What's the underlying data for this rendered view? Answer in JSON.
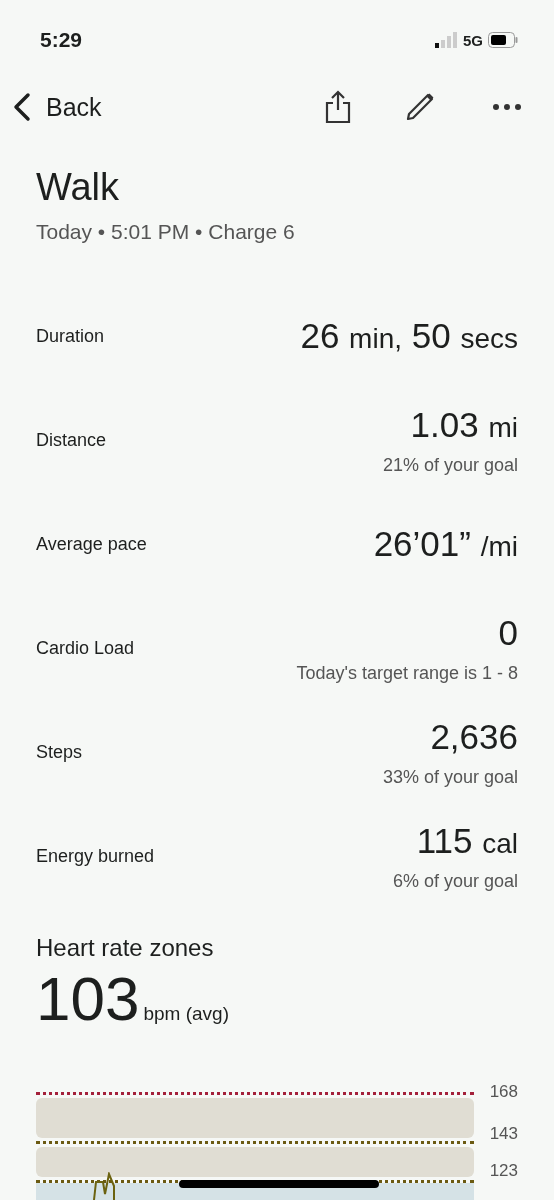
{
  "status_bar": {
    "time": "5:29",
    "network": "5G"
  },
  "nav": {
    "back_label": "Back"
  },
  "title": "Walk",
  "subtitle": "Today • 5:01 PM • Charge 6",
  "metrics": [
    {
      "label": "Duration",
      "value": [
        {
          "kind": "number",
          "text": "26"
        },
        {
          "kind": "unit",
          "text": "min,"
        },
        {
          "kind": "number",
          "text": "50"
        },
        {
          "kind": "unit",
          "text": "secs"
        }
      ]
    },
    {
      "label": "Distance",
      "value": [
        {
          "kind": "number",
          "text": "1.03"
        },
        {
          "kind": "unit",
          "text": "mi"
        }
      ],
      "note": "21% of your goal"
    },
    {
      "label": "Average pace",
      "value": [
        {
          "kind": "number",
          "text": "26’01”"
        },
        {
          "kind": "unit",
          "text": "/mi"
        }
      ]
    },
    {
      "label": "Cardio Load",
      "value": [
        {
          "kind": "number",
          "text": "0"
        }
      ],
      "note": "Today's target range is 1 - 8"
    },
    {
      "label": "Steps",
      "value": [
        {
          "kind": "number",
          "text": "2,636"
        }
      ],
      "note": "33% of your goal"
    },
    {
      "label": "Energy burned",
      "value": [
        {
          "kind": "number",
          "text": "115"
        },
        {
          "kind": "unit",
          "text": "cal"
        }
      ],
      "note": "6% of your goal"
    }
  ],
  "heart_rate": {
    "heading": "Heart rate zones",
    "average": "103",
    "unit": "bpm (avg)",
    "chart_ticks": [
      {
        "label": "168",
        "color": "#a3203a"
      },
      {
        "label": "143",
        "color": "#6b5a12"
      },
      {
        "label": "123",
        "color": "#6b5a12"
      }
    ]
  }
}
